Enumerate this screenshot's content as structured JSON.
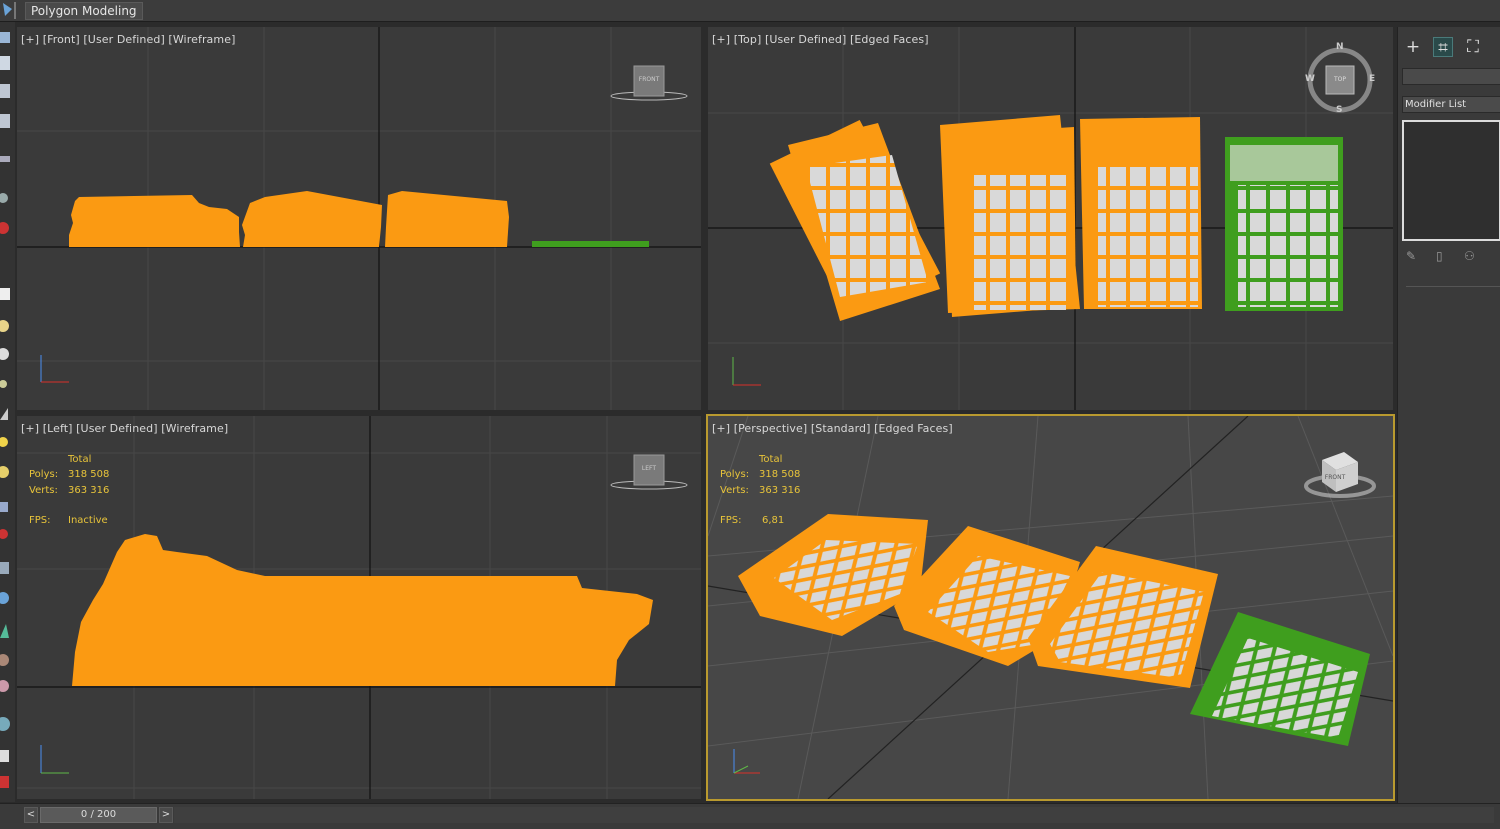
{
  "ribbon": {
    "tab_label": "Polygon Modeling"
  },
  "viewports": {
    "front": {
      "label": "[+] [Front] [User Defined] [Wireframe]",
      "viewcube_face": "FRONT"
    },
    "top": {
      "label": "[+] [Top] [User Defined] [Edged Faces]",
      "viewcube_face": "TOP",
      "compass": {
        "n": "N",
        "s": "S",
        "e": "E",
        "w": "W"
      }
    },
    "left": {
      "label": "[+] [Left] [User Defined] [Wireframe]",
      "viewcube_face": "LEFT",
      "stats": {
        "total": "Total",
        "polys_label": "Polys:",
        "polys": "318 508",
        "verts_label": "Verts:",
        "verts": "363 316",
        "fps_label": "FPS:",
        "fps": "Inactive"
      }
    },
    "perspective": {
      "label": "[+] [Perspective] [Standard] [Edged Faces]",
      "viewcube_face": "FRONT",
      "stats": {
        "total": "Total",
        "polys_label": "Polys:",
        "polys": "318 508",
        "verts_label": "Verts:",
        "verts": "363 316",
        "fps_label": "FPS:",
        "fps": "6,81"
      }
    }
  },
  "command_panel": {
    "tabs": [
      {
        "icon": "plus-icon",
        "glyph": "+"
      },
      {
        "icon": "modify-icon",
        "glyph": "⌗"
      },
      {
        "icon": "hierarchy-icon",
        "glyph": "⛶"
      }
    ],
    "modifier_list_label": "Modifier List",
    "stack_tools": [
      "pin-icon",
      "show-result-icon",
      "make-unique-icon"
    ]
  },
  "time_slider": {
    "value": "0 / 200",
    "prev_glyph": "<",
    "next_glyph": ">"
  },
  "colors": {
    "selected": "#fb9a12",
    "green_object": "#3f9e1e",
    "active_border": "#b99a2f",
    "viewport_bg": "#3a3a3a",
    "stats_text": "#e8c43a"
  }
}
